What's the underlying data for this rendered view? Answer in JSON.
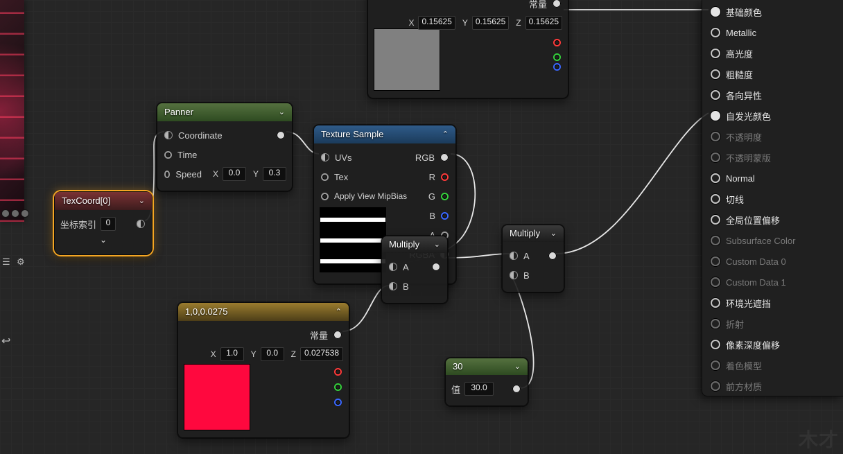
{
  "nodes": {
    "const3": {
      "label_changliang": "常量",
      "x": "0.15625",
      "y": "0.15625",
      "z": "0.15625"
    },
    "texcoord": {
      "title": "TexCoord[0]",
      "index_label": "坐标索引",
      "index_value": "0"
    },
    "panner": {
      "title": "Panner",
      "coordinate": "Coordinate",
      "time": "Time",
      "speed": "Speed",
      "sx": "0.0",
      "sy": "0.3"
    },
    "texsample": {
      "title": "Texture Sample",
      "uvs": "UVs",
      "tex": "Tex",
      "mip": "Apply View MipBias",
      "rgb": "RGB",
      "r": "R",
      "g": "G",
      "b": "B",
      "a": "A",
      "rgba": "RGBA"
    },
    "multiply1": {
      "title": "Multiply",
      "a": "A",
      "b": "B"
    },
    "multiply2": {
      "title": "Multiply",
      "a": "A",
      "b": "B"
    },
    "color": {
      "title": "1,0,0.0275",
      "label_changliang": "常量",
      "x": "1.0",
      "y": "0.0",
      "z": "0.027538"
    },
    "scalar": {
      "title": "30",
      "value_label": "值",
      "value": "30.0"
    }
  },
  "outputs": {
    "base_color": "基础颜色",
    "metallic": "Metallic",
    "specular": "高光度",
    "roughness": "粗糙度",
    "anisotropy": "各向异性",
    "emissive": "自发光颜色",
    "opacity": "不透明度",
    "opacity_mask": "不透明蒙版",
    "normal": "Normal",
    "tangent": "切线",
    "wpo": "全局位置偏移",
    "subsurface": "Subsurface Color",
    "custom0": "Custom Data 0",
    "custom1": "Custom Data 1",
    "ao": "环境光遮挡",
    "refraction": "折射",
    "pdo": "像素深度偏移",
    "shading_model": "着色模型",
    "front_material": "前方材质"
  }
}
